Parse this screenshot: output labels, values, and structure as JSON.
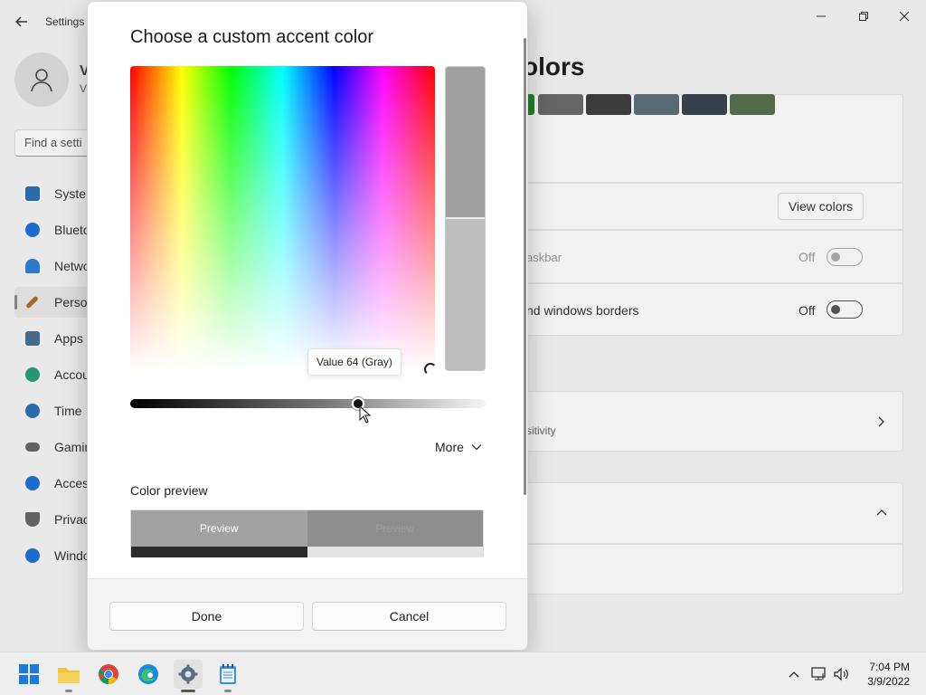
{
  "settings": {
    "title": "Settings",
    "user_name_clip": "V",
    "user_sub_clip": "V",
    "search_placeholder": "Find a setti",
    "nav": [
      {
        "label": "Syster",
        "color": "#2b6fb5"
      },
      {
        "label": "Blueto",
        "color": "#1f6fd6"
      },
      {
        "label": "Netwo",
        "color": "#2b7fd6"
      },
      {
        "label": "Perso",
        "color": "#b06a2a"
      },
      {
        "label": "Apps",
        "color": "#4a6d8c"
      },
      {
        "label": "Accou",
        "color": "#2a9d7a"
      },
      {
        "label": "Time",
        "color": "#2b6fb5"
      },
      {
        "label": "Gamin",
        "color": "#666666"
      },
      {
        "label": "Acces",
        "color": "#1f6fd6"
      },
      {
        "label": "Privac",
        "color": "#666666"
      },
      {
        "label": "Windo",
        "color": "#1f6fd6"
      }
    ],
    "heading_clip": "olors",
    "swatches": [
      "#1f8a2a",
      "#6a6a6a",
      "#3e3e3e",
      "#5c6e78",
      "#3a4450",
      "#55704f"
    ],
    "view_colors": "View colors",
    "row_taskbar": "askbar",
    "row_taskbar_state": "Off",
    "row_borders": "nd windows borders",
    "row_borders_state": "Off",
    "row_transparency": "sitivity"
  },
  "dialog": {
    "title": "Choose a custom accent color",
    "tooltip": "Value 64 (Gray)",
    "slider_value_fraction": 0.64,
    "more_label": "More",
    "preview_label": "Color preview",
    "preview_left": "Preview",
    "preview_right": "Preview",
    "done": "Done",
    "cancel": "Cancel"
  },
  "taskbar": {
    "time": "7:04 PM",
    "date": "3/9/2022"
  }
}
